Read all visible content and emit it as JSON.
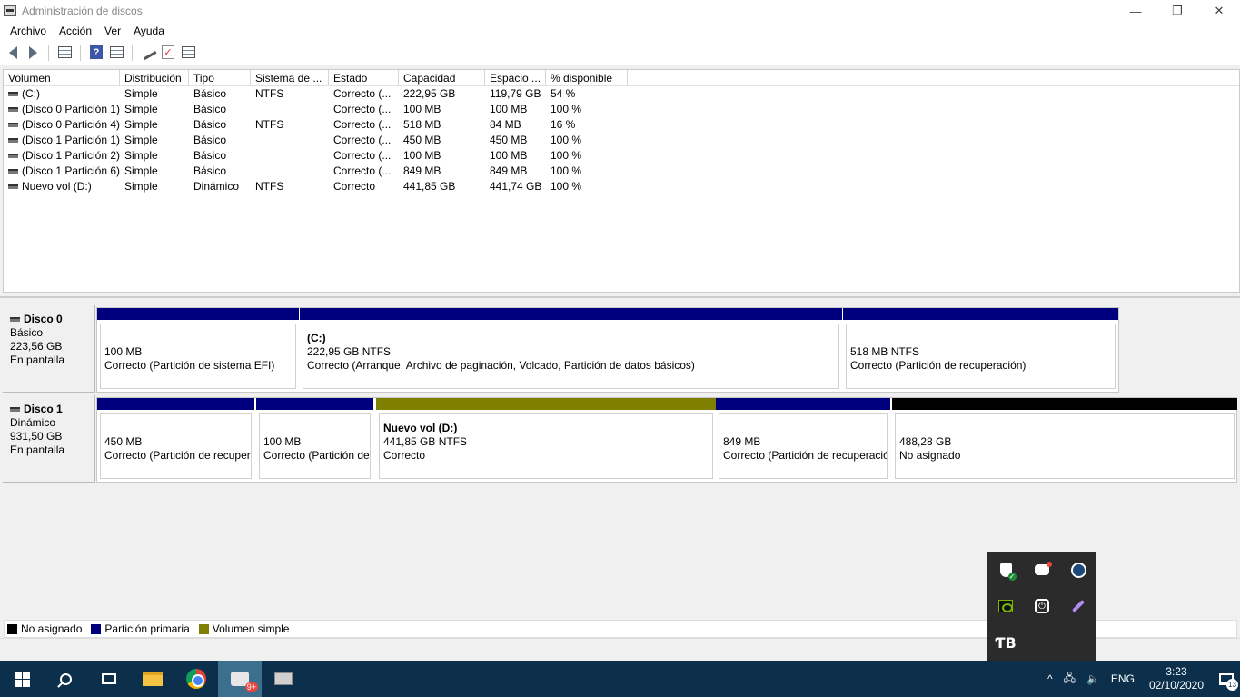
{
  "window": {
    "title": "Administración de discos",
    "minimize": "—",
    "maximize": "❐",
    "close": "✕"
  },
  "menu": [
    "Archivo",
    "Acción",
    "Ver",
    "Ayuda"
  ],
  "toolbar": {
    "help_glyph": "?",
    "check_glyph": "✓"
  },
  "volume_list": {
    "columns": [
      "Volumen",
      "Distribución",
      "Tipo",
      "Sistema de ...",
      "Estado",
      "Capacidad",
      "Espacio ...",
      "% disponible"
    ],
    "rows": [
      [
        "(C:)",
        "Simple",
        "Básico",
        "NTFS",
        "Correcto (...",
        "222,95 GB",
        "119,79 GB",
        "54 %"
      ],
      [
        "(Disco 0 Partición 1)",
        "Simple",
        "Básico",
        "",
        "Correcto (...",
        "100 MB",
        "100 MB",
        "100 %"
      ],
      [
        "(Disco 0 Partición 4)",
        "Simple",
        "Básico",
        "NTFS",
        "Correcto (...",
        "518 MB",
        "84 MB",
        "16 %"
      ],
      [
        "(Disco 1 Partición 1)",
        "Simple",
        "Básico",
        "",
        "Correcto (...",
        "450 MB",
        "450 MB",
        "100 %"
      ],
      [
        "(Disco 1 Partición 2)",
        "Simple",
        "Básico",
        "",
        "Correcto (...",
        "100 MB",
        "100 MB",
        "100 %"
      ],
      [
        "(Disco 1 Partición 6)",
        "Simple",
        "Básico",
        "",
        "Correcto (...",
        "849 MB",
        "849 MB",
        "100 %"
      ],
      [
        "Nuevo vol (D:)",
        "Simple",
        "Dinámico",
        "NTFS",
        "Correcto",
        "441,85 GB",
        "441,74 GB",
        "100 %"
      ]
    ]
  },
  "disks": [
    {
      "name": "Disco 0",
      "type": "Básico",
      "size": "223,56 GB",
      "status": "En pantalla",
      "partitions": [
        {
          "name": "",
          "size": "100 MB",
          "desc": "Correcto (Partición de sistema EFI)",
          "color": "#00007f"
        },
        {
          "name": "(C:)",
          "size": "222,95 GB NTFS",
          "desc": "Correcto (Arranque, Archivo de paginación, Volcado, Partición de datos básicos)",
          "color": "#00007f"
        },
        {
          "name": "",
          "size": "518 MB NTFS",
          "desc": "Correcto (Partición de recuperación)",
          "color": "#00007f"
        }
      ]
    },
    {
      "name": "Disco 1",
      "type": "Dinámico",
      "size": "931,50 GB",
      "status": "En pantalla",
      "partitions": [
        {
          "name": "",
          "size": "450 MB",
          "desc": "Correcto (Partición de recuper",
          "color": "#00007f"
        },
        {
          "name": "",
          "size": "100 MB",
          "desc": "Correcto (Partición de",
          "color": "#00007f"
        },
        {
          "name": "Nuevo vol  (D:)",
          "size": "441,85 GB NTFS",
          "desc": "Correcto",
          "color": "#808000"
        },
        {
          "name": "",
          "size": "849 MB",
          "desc": "Correcto (Partición de recuperació",
          "color": "#00007f"
        },
        {
          "name": "",
          "size": "488,28 GB",
          "desc": "No asignado",
          "color": "#000000"
        }
      ]
    }
  ],
  "legend": [
    {
      "label": "No asignado",
      "color": "#000000"
    },
    {
      "label": "Partición primaria",
      "color": "#00007f"
    },
    {
      "label": "Volumen simple",
      "color": "#808000"
    }
  ],
  "taskbar": {
    "badge": "9+",
    "tray_chevron": "^",
    "volume_glyph": "🔈",
    "language": "ENG",
    "time": "3:23",
    "date": "02/10/2020",
    "notification_count": "13"
  },
  "tray_popup": {
    "power_glyph": "⏻",
    "logo_text": "ƬB"
  }
}
